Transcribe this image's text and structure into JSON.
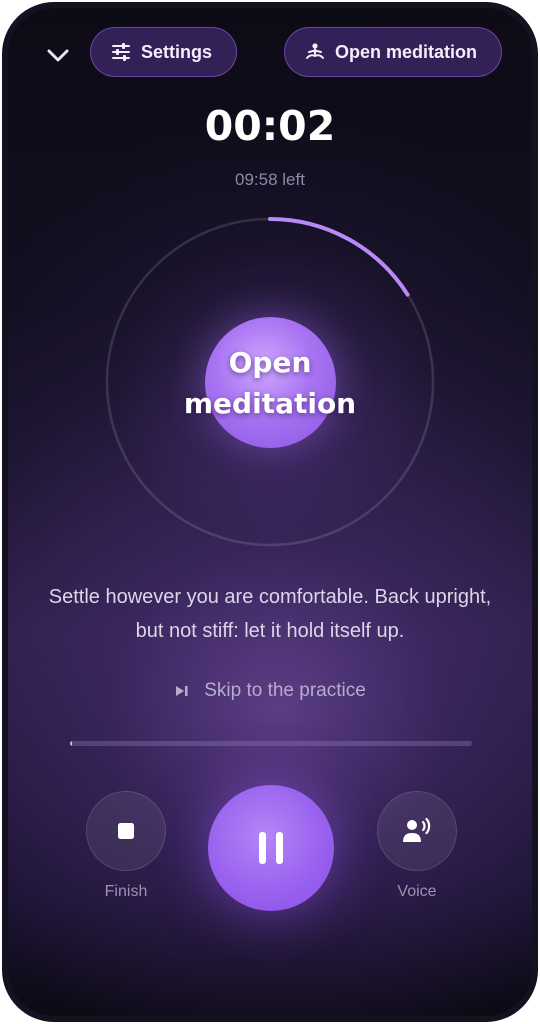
{
  "header": {
    "collapse_icon": "chevron-down-icon",
    "settings_label": "Settings",
    "settings_icon": "sliders-icon",
    "practice_label": "Open meditation",
    "practice_icon": "meditation-icon"
  },
  "timer": {
    "elapsed": "00:02",
    "remaining": "09:58 left",
    "ring_progress": 0.16
  },
  "orb": {
    "line1": "Open",
    "line2": "meditation"
  },
  "instruction": "Settle however you are comfortable. Back upright, but not stiff: let it hold itself up.",
  "skip": {
    "label": "Skip to the practice",
    "icon": "skip-forward-icon"
  },
  "session_progress": 0.003,
  "controls": {
    "finish_label": "Finish",
    "finish_icon": "stop-icon",
    "play_pause_icon": "pause-icon",
    "voice_label": "Voice",
    "voice_icon": "voice-icon"
  },
  "colors": {
    "accent": "#9a62ef",
    "ring_progress": "#b88af5",
    "background": "#130f21"
  }
}
